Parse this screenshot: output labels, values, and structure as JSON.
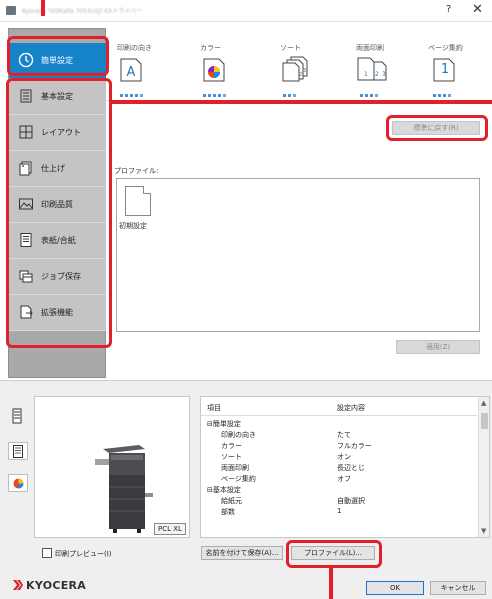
{
  "window": {
    "title": "Kyocera TASKalfa 7054ci(J) KXドライバー",
    "help_glyph": "?",
    "close_glyph": "✕"
  },
  "sidebar": {
    "items": [
      {
        "label": "簡単設定",
        "icon": "clock-icon"
      },
      {
        "label": "基本設定",
        "icon": "document-list-icon"
      },
      {
        "label": "レイアウト",
        "icon": "layout-grid-icon"
      },
      {
        "label": "仕上げ",
        "icon": "finishing-icon"
      },
      {
        "label": "印刷品質",
        "icon": "image-quality-icon"
      },
      {
        "label": "表紙/合紙",
        "icon": "cover-page-icon"
      },
      {
        "label": "ジョブ保存",
        "icon": "job-storage-icon"
      },
      {
        "label": "拡張機能",
        "icon": "extension-icon"
      }
    ],
    "active_color": "#1682c8"
  },
  "quick": {
    "columns": [
      {
        "label": "印刷の向き",
        "icon": "orientation-a-icon"
      },
      {
        "label": "カラー",
        "icon": "color-palette-icon"
      },
      {
        "label": "ソート",
        "icon": "collate-icon"
      },
      {
        "label": "両面印刷",
        "icon": "duplex-icon"
      },
      {
        "label": "ページ集約",
        "icon": "page-per-sheet-icon"
      }
    ],
    "page_per_sheet_value": "1",
    "reset_label": "標準に戻す(R)"
  },
  "profile": {
    "label": "プロファイル:",
    "items": [
      {
        "name": "初期設定"
      }
    ],
    "apply_label": "適用(Z)"
  },
  "preview": {
    "badge": "PCL XL",
    "checkbox_label": "印刷プレビュー(I)"
  },
  "summary": {
    "headers": [
      "項目",
      "設定内容"
    ],
    "rows": [
      {
        "item": "⊟簡単設定",
        "value": "",
        "level": 0
      },
      {
        "item": "印刷の向き",
        "value": "たて",
        "level": 1
      },
      {
        "item": "カラー",
        "value": "フルカラー",
        "level": 1
      },
      {
        "item": "ソート",
        "value": "オン",
        "level": 1
      },
      {
        "item": "両面印刷",
        "value": "長辺とじ",
        "level": 1
      },
      {
        "item": "ページ集約",
        "value": "オフ",
        "level": 1
      },
      {
        "item": "⊟基本設定",
        "value": "",
        "level": 0
      },
      {
        "item": "給紙元",
        "value": "自動選択",
        "level": 1
      },
      {
        "item": "部数",
        "value": "1",
        "level": 1
      }
    ]
  },
  "buttons": {
    "save_as": "名前を付けて保存(A)...",
    "profile": "プロファイル(L)...",
    "ok": "OK",
    "cancel": "キャンセル"
  },
  "brand": {
    "name": "KYOCERA",
    "color": "#d6262f"
  },
  "annotation_color": "#e0202a"
}
